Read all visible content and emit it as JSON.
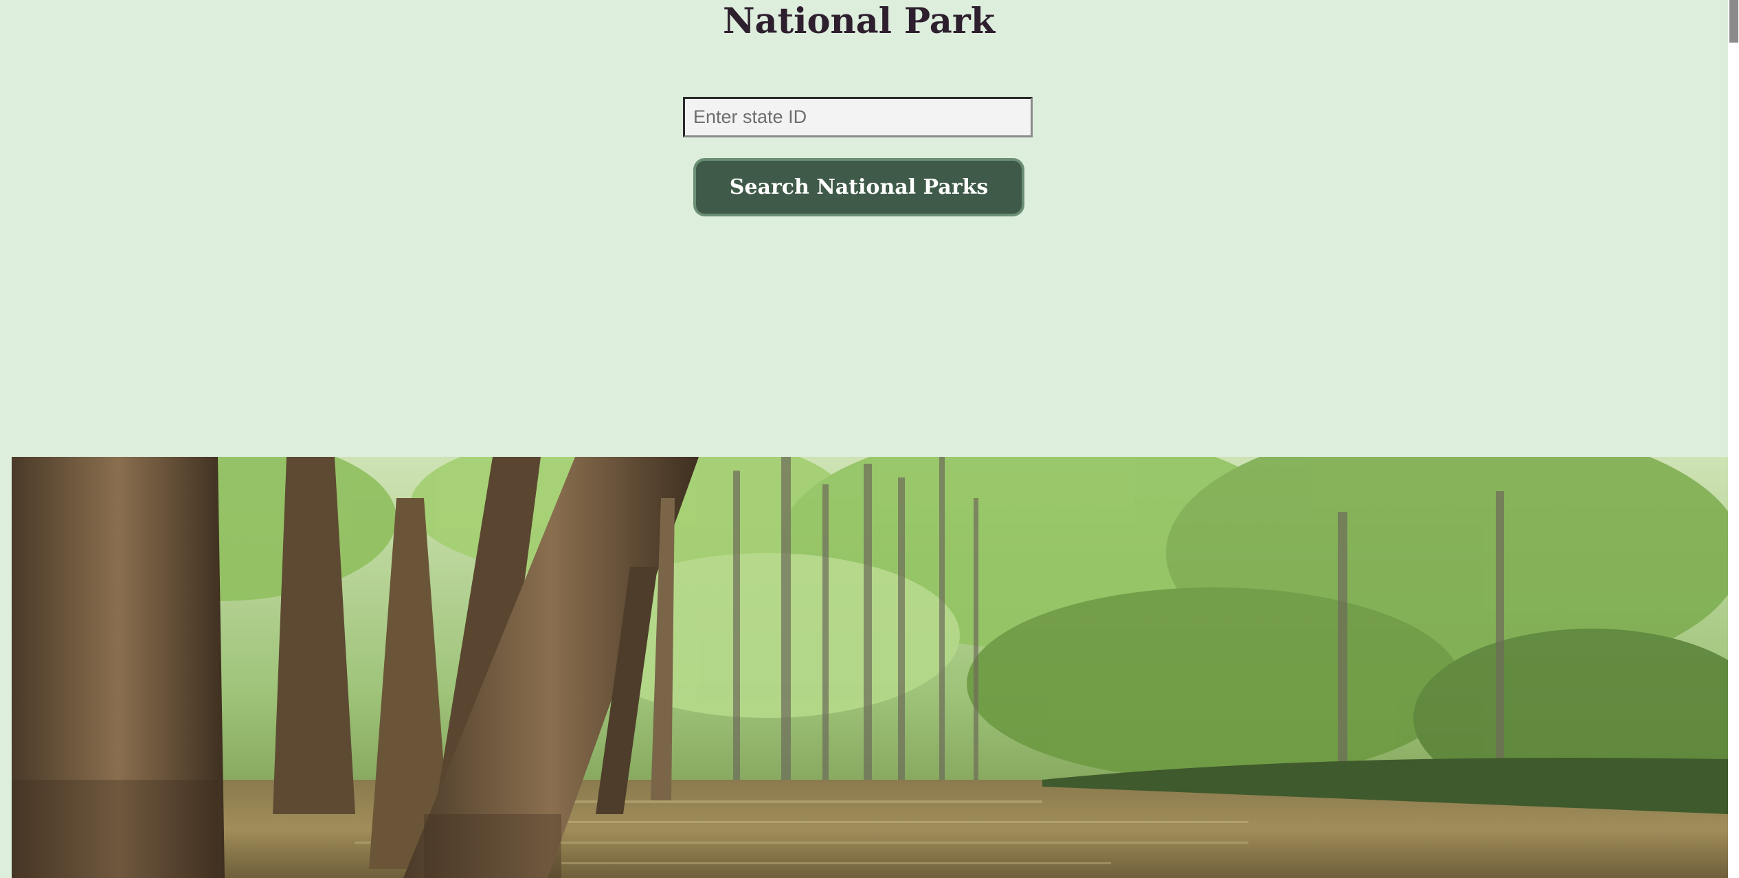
{
  "header": {
    "title": "National Park"
  },
  "search": {
    "placeholder": "Enter state ID",
    "value": "",
    "button_label": "Search National Parks"
  },
  "hero": {
    "image_subject": "flooded-forest-photo"
  },
  "colors": {
    "background": "#ddeedd",
    "title": "#2e1f2e",
    "button": "#3f5a48",
    "button_border": "#6b8f74"
  }
}
